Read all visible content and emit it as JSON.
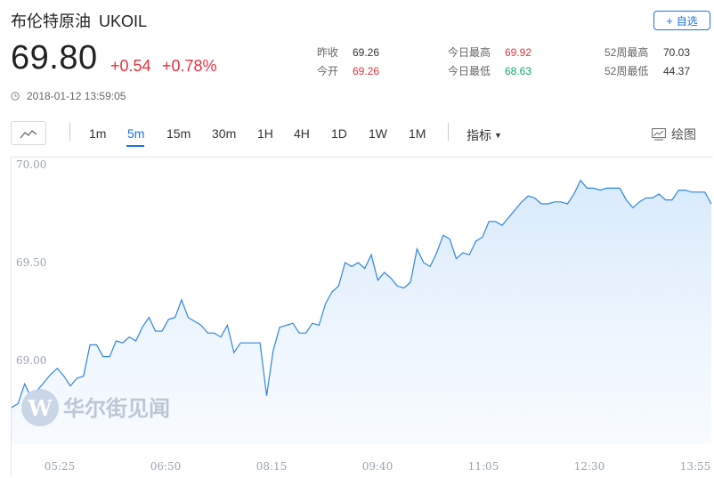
{
  "header": {
    "name": "布伦特原油",
    "code": "UKOIL",
    "watch_label": "自选",
    "price": "69.80",
    "change": "+0.54",
    "change_pct": "+0.78%",
    "timestamp": "2018-01-12 13:59:05"
  },
  "stats": {
    "prev_close_label": "昨收",
    "prev_close": "69.26",
    "open_label": "今开",
    "open": "69.26",
    "high_label": "今日最高",
    "high": "69.92",
    "low_label": "今日最低",
    "low": "68.63",
    "w52_high_label": "52周最高",
    "w52_high": "70.03",
    "w52_low_label": "52周最低",
    "w52_low": "44.37"
  },
  "toolbar": {
    "timeframes": [
      "1m",
      "5m",
      "15m",
      "30m",
      "1H",
      "4H",
      "1D",
      "1W",
      "1M"
    ],
    "active": "5m",
    "indicator_label": "指标",
    "draw_label": "绘图"
  },
  "watermark": "华尔街见闻",
  "colors": {
    "up": "#e5323e",
    "down": "#12a66b",
    "accent": "#1a73e8",
    "line": "#2f86e0"
  },
  "chart_data": {
    "type": "area",
    "title": "",
    "xlabel": "",
    "ylabel": "",
    "ylim": [
      68.6,
      70.05
    ],
    "y_ticks": [
      "70.00",
      "69.50",
      "69.00"
    ],
    "x_ticks": [
      "05:25",
      "06:50",
      "08:15",
      "09:40",
      "11:05",
      "12:30",
      "13:55"
    ],
    "grid": false,
    "series": [
      {
        "values": [
          68.76,
          68.78,
          68.88,
          68.81,
          68.85,
          68.89,
          68.93,
          68.96,
          68.92,
          68.87,
          68.91,
          68.92,
          69.08,
          69.08,
          69.02,
          69.02,
          69.1,
          69.09,
          69.12,
          69.1,
          69.17,
          69.22,
          69.15,
          69.15,
          69.21,
          69.22,
          69.31,
          69.22,
          69.2,
          69.18,
          69.14,
          69.14,
          69.12,
          69.18,
          69.04,
          69.09,
          69.09,
          69.09,
          69.09,
          68.82,
          69.05,
          69.17,
          69.18,
          69.19,
          69.14,
          69.14,
          69.19,
          69.18,
          69.29,
          69.35,
          69.38,
          69.5,
          69.48,
          69.5,
          69.47,
          69.54,
          69.41,
          69.45,
          69.42,
          69.38,
          69.37,
          69.4,
          69.57,
          69.5,
          69.48,
          69.55,
          69.64,
          69.62,
          69.52,
          69.55,
          69.54,
          69.61,
          69.63,
          69.71,
          69.71,
          69.69,
          69.73,
          69.77,
          69.81,
          69.84,
          69.83,
          69.8,
          69.8,
          69.81,
          69.81,
          69.8,
          69.85,
          69.92,
          69.88,
          69.88,
          69.87,
          69.88,
          69.88,
          69.88,
          69.82,
          69.78,
          69.81,
          69.83,
          69.83,
          69.85,
          69.82,
          69.82,
          69.87,
          69.87,
          69.86,
          69.86,
          69.86,
          69.8
        ]
      }
    ]
  }
}
